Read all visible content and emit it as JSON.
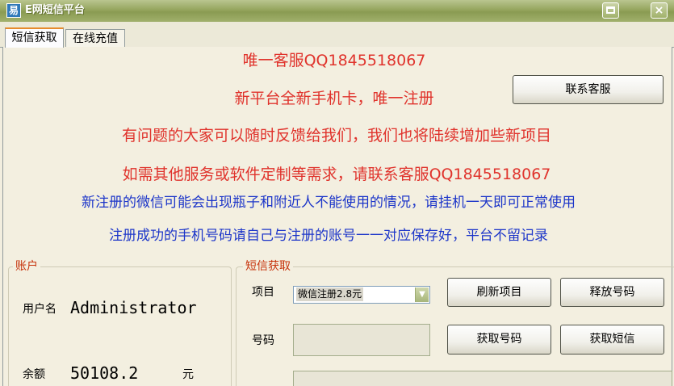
{
  "window": {
    "title": "E网短信平台",
    "app_icon_glyph": "易",
    "maximize_icon": "maximize-icon",
    "close_glyph": "×"
  },
  "tabs": [
    {
      "label": "短信获取",
      "active": true
    },
    {
      "label": "在线充值",
      "active": false
    }
  ],
  "notices": {
    "line1": "唯一客服QQ1845518067",
    "line2": "新平台全新手机卡，唯一注册",
    "line3": "有问题的大家可以随时反馈给我们，我们也将陆续增加些新项目",
    "line4": "如需其他服务或软件定制等需求，请联系客服QQ1845518067",
    "line5": "新注册的微信可能会出现瓶子和附近人不能使用的情况，请挂机一天即可正常使用",
    "line6": "注册成功的手机号码请自己与注册的账号一一对应保存好，平台不留记录"
  },
  "contact_button": "联系客服",
  "account": {
    "group_label": "账户",
    "username_label": "用户名",
    "username": "Administrator",
    "balance_label": "余额",
    "balance": "50108.2",
    "balance_unit": "元"
  },
  "sms": {
    "group_label": "短信获取",
    "project_label": "项目",
    "project_selected": "微信注册2.8元",
    "number_label": "号码",
    "number_value": "",
    "buttons": {
      "refresh": "刷新项目",
      "release": "释放号码",
      "get_number": "获取号码",
      "get_sms": "获取短信"
    }
  },
  "colors": {
    "title_bar": "#95a55e",
    "notice_red": "#e0332c",
    "notice_blue": "#1d36c9",
    "group_label": "#c7340d",
    "background": "#f3efe0"
  }
}
